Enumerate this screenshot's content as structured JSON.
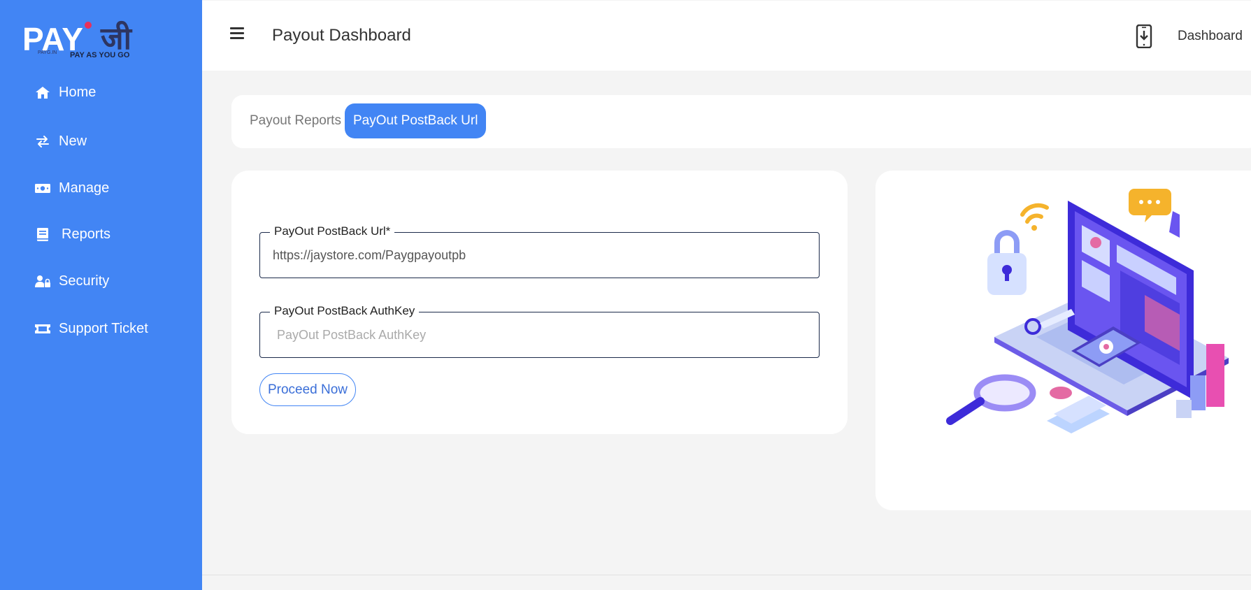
{
  "brand": {
    "logo_main": "PAY",
    "logo_devanagari": "जी",
    "logo_small": "PAYG.IN",
    "logo_tagline": "PAY AS YOU GO"
  },
  "sidebar": {
    "items": [
      {
        "label": "Home",
        "icon": "home-icon"
      },
      {
        "label": "New",
        "icon": "exchange-icon"
      },
      {
        "label": "Manage",
        "icon": "money-icon"
      },
      {
        "label": "Reports",
        "icon": "book-icon"
      },
      {
        "label": "Security",
        "icon": "user-lock-icon"
      },
      {
        "label": "Support Ticket",
        "icon": "ticket-icon"
      }
    ]
  },
  "header": {
    "title": "Payout Dashboard",
    "dashboard_link": "Dashboard"
  },
  "tabs": [
    {
      "label": "Payout Reports",
      "active": false
    },
    {
      "label": "PayOut PostBack Url",
      "active": true
    }
  ],
  "form": {
    "url_legend": "PayOut PostBack Url*",
    "url_value": "https://jaystore.com/Paygpayoutpb",
    "auth_legend": "PayOut PostBack AuthKey",
    "auth_placeholder": "PayOut PostBack AuthKey",
    "auth_value": "",
    "submit_label": "Proceed Now"
  },
  "colors": {
    "primary": "#4285f4",
    "sidebar_bg": "#4285f4",
    "page_bg": "#f4f4f4",
    "field_border": "#1b2a4a"
  }
}
